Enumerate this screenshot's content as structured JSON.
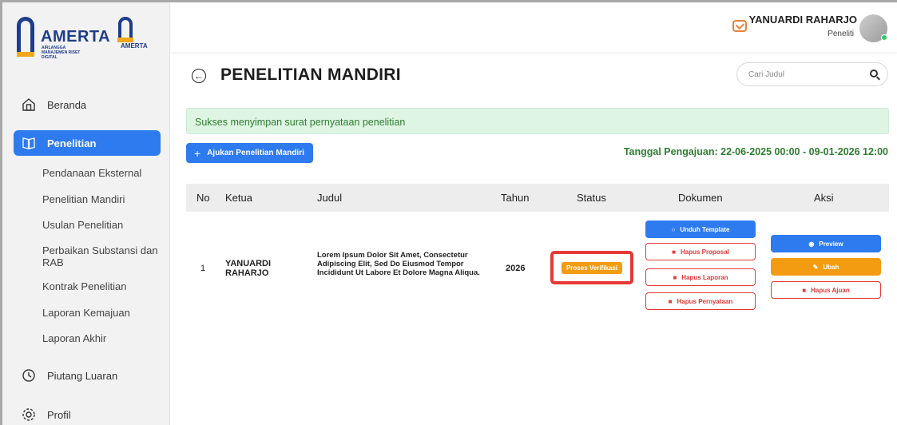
{
  "brand": {
    "name": "AMERTA",
    "tagline": "AIRLANGGA MANAJEMEN RISET DIGITAL",
    "small": "AMERTA"
  },
  "sidebar": {
    "items": [
      {
        "label": "Beranda",
        "icon": "home-icon"
      },
      {
        "label": "Penelitian",
        "icon": "book-icon",
        "active": true
      },
      {
        "label": "Piutang Luaran",
        "icon": "clock-icon"
      },
      {
        "label": "Profil",
        "icon": "gear-icon"
      }
    ],
    "subitems": [
      "Pendanaan Eksternal",
      "Penelitian Mandiri",
      "Usulan Penelitian",
      "Perbaikan Substansi dan RAB",
      "Kontrak Penelitian",
      "Laporan Kemajuan",
      "Laporan Akhir"
    ]
  },
  "header": {
    "user_name": "YANUARDI RAHARJO",
    "user_role": "Peneliti"
  },
  "page": {
    "title": "PENELITIAN MANDIRI",
    "search_placeholder": "Cari Judul",
    "alert": "Sukses menyimpan surat pernyataan penelitian",
    "add_button": "Ajukan Penelitian Mandiri",
    "date_range": "Tanggal Pengajuan: 22-06-2025 00:00 - 09-01-2026 12:00"
  },
  "table": {
    "headers": [
      "No",
      "Ketua",
      "Judul",
      "Tahun",
      "Status",
      "Dokumen",
      "Aksi"
    ],
    "rows": [
      {
        "no": "1",
        "ketua": "YANUARDI RAHARJO",
        "judul": "Lorem Ipsum Dolor Sit Amet, Consectetur Adipiscing Elit, Sed Do Eiusmod Tempor Incididunt Ut Labore Et Dolore Magna Aliqua.",
        "tahun": "2026",
        "status": "Proses Verifikasi",
        "dokumen": [
          "Unduh Template",
          "Hapus Proposal",
          "Hapus Laporan",
          "Hapus Pernyataan"
        ],
        "aksi": [
          "Preview",
          "Ubah",
          "Hapus Ajuan"
        ]
      }
    ]
  },
  "colors": {
    "primary": "#2e7bef",
    "success_text": "#2e7d32",
    "alert_bg": "#dff5e3",
    "status_badge": "#f39c12",
    "danger": "#e53935",
    "brand": "#1e3c8a"
  }
}
